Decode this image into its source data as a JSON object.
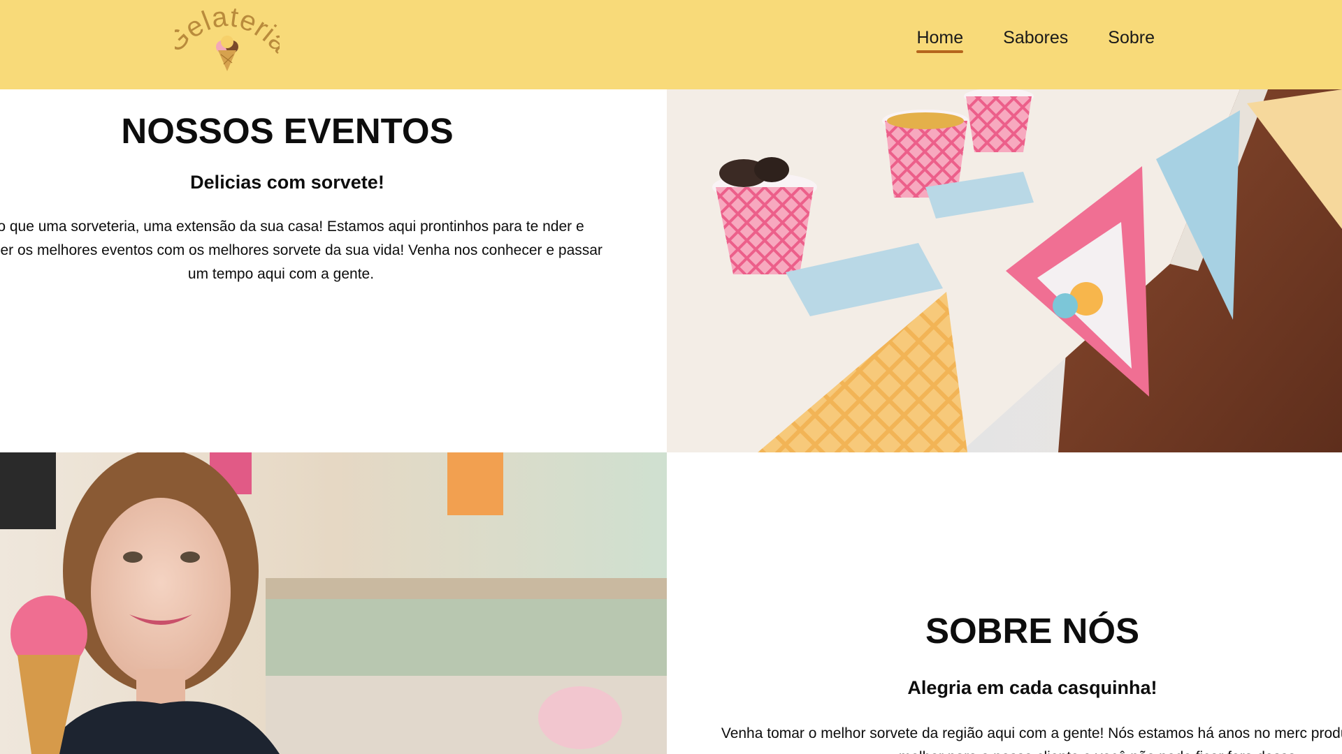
{
  "header": {
    "logo_text": "Gelateria",
    "nav": [
      {
        "label": "Home",
        "active": true
      },
      {
        "label": "Sabores",
        "active": false
      },
      {
        "label": "Sobre",
        "active": false
      }
    ]
  },
  "events": {
    "title": "NOSSOS EVENTOS",
    "subtitle": "Delicias com sorvete!",
    "body": "s do que uma sorveteria, uma extensão da sua casa! Estamos aqui prontinhos para te nder e oferecer os melhores eventos com os melhores sorvete da sua vida! Venha nos conhecer e passar um tempo aqui com a gente."
  },
  "about": {
    "title": "SOBRE NÓS",
    "subtitle": "Alegria em cada casquinha!",
    "body": "Venha tomar o melhor sorvete da região aqui com a gente! Nós estamos há anos no merc produzindo o que tem de melhor para o nosso cliente e você não pode ficar fora dessa"
  },
  "colors": {
    "header_bg": "#f8da79",
    "nav_active_underline": "#b5651d",
    "logo": "#b98b3c"
  },
  "icons": {
    "logo": "ice-cream-cone-logo"
  }
}
